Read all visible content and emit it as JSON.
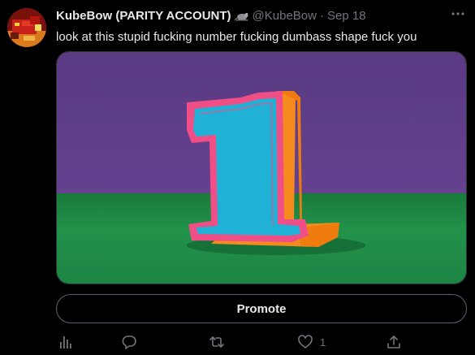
{
  "tweet": {
    "author": {
      "display_name": "KubeBow (PARITY ACCOUNT)",
      "badge_icon": "rat-emoji-icon",
      "handle": "@KubeBow",
      "separator": "·",
      "date": "Sep 18"
    },
    "text": "look at this stupid fucking number fucking dumbass shape fuck you",
    "media": {
      "subject": "paper-cutout-number-one-image",
      "colors": {
        "background_wall": "#5c3c86",
        "floor": "#1f8a4c",
        "front_face": "#1fb2d6",
        "outline": "#ef4f86",
        "side": "#f58a1f"
      }
    },
    "promote_label": "Promote",
    "actions": {
      "analytics_icon": "bar-chart-icon",
      "reply_icon": "speech-bubble-icon",
      "retweet_icon": "retweet-arrows-icon",
      "like_icon": "heart-icon",
      "like_count": "1",
      "share_icon": "share-upload-icon"
    },
    "colors": {
      "text_primary": "#e7e9ea",
      "text_secondary": "#71767b",
      "background": "#000000"
    }
  }
}
